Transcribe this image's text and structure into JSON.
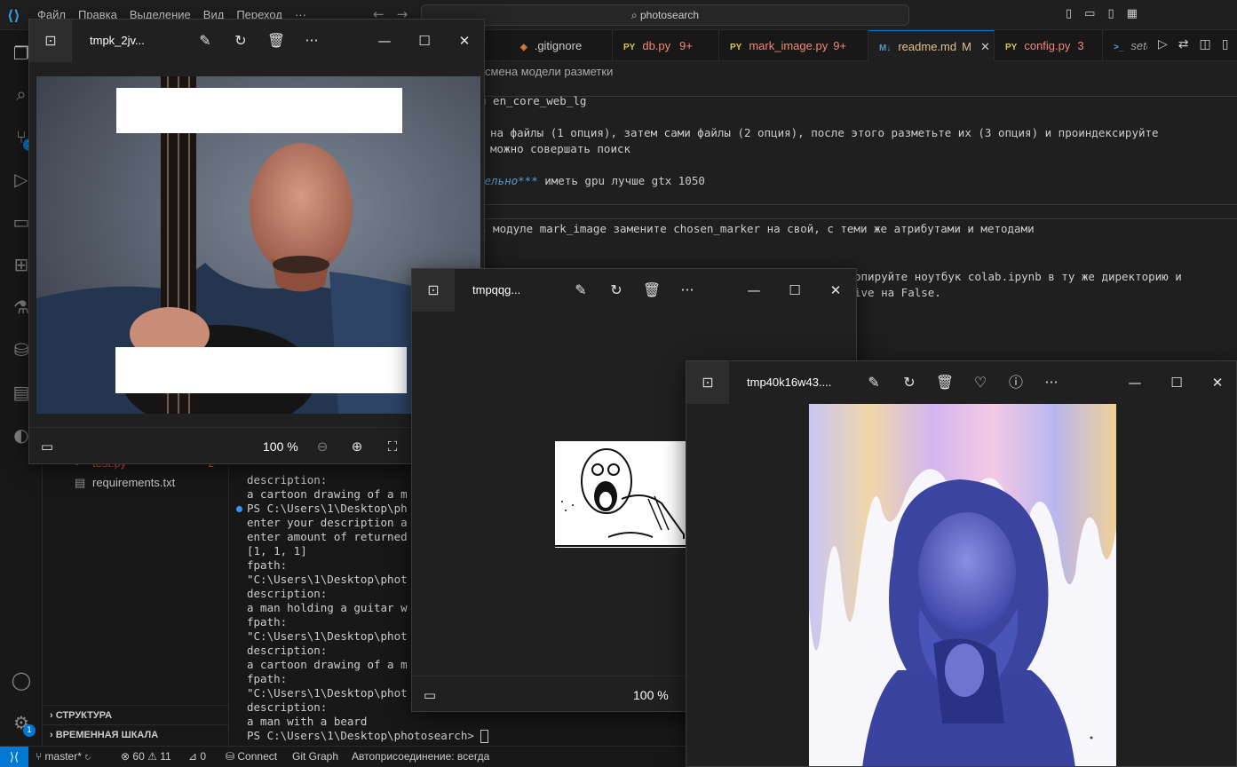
{
  "titlebar": {
    "menu": [
      "Файл",
      "Правка",
      "Выделение",
      "Вид",
      "Переход",
      "···"
    ],
    "search": "photosearch"
  },
  "activity": {
    "icons": [
      "files-icon",
      "search-icon",
      "source-control-icon",
      "run-debug-icon",
      "remote-explorer-icon",
      "extensions-icon",
      "testing-icon",
      "database-icon",
      "docker-icon",
      "gitlens-icon"
    ],
    "scm_badge": "1",
    "settings_badge": "1"
  },
  "sidebar": {
    "files": [
      {
        "name": "test.py",
        "count": "2"
      },
      {
        "name": "requirements.txt"
      }
    ],
    "sections": [
      "СТРУКТУРА",
      "ВРЕМЕННАЯ ШКАЛА"
    ]
  },
  "tabs": [
    {
      "type": "◈",
      "name": ".gitignore",
      "color": "#cccccc"
    },
    {
      "type": "PY",
      "name": "db.py",
      "badge": "9+",
      "color": "#f48771"
    },
    {
      "type": "PY",
      "name": "mark_image.py",
      "badge": "9+",
      "color": "#f48771"
    },
    {
      "type": "M↓",
      "name": "readme.md",
      "badge": "M",
      "color": "#e2c08d"
    },
    {
      "type": "PY",
      "name": "config.py",
      "badge": "3",
      "color": "#f48771"
    },
    {
      "type": ">_",
      "name": "setu",
      "color": "#a0a0a0"
    }
  ],
  "editor": {
    "breadcrumb": "смена модели разметки",
    "lines": [
      "u en_core_web_lg",
      "на файлы (1 опция), затем сами файлы (2 опция), после этого разметьте их (3 опция) и проиндексируйте",
      "можно совершать поиск",
      "тельно***",
      " иметь gpu лучше gtx 1050",
      "в модуле mark_image замените chosen_marker на свой, с теми же атрибутами и методами",
      "опируйте ноутбук colab.ipynb в ту же директорию и",
      "ive на False."
    ]
  },
  "terminal": {
    "lines": [
      "description:",
      "a cartoon drawing of a m",
      "PS C:\\Users\\1\\Desktop\\ph",
      "enter your description a",
      "enter amount of returned",
      "[1, 1, 1]",
      "fpath:",
      "\"C:\\Users\\1\\Desktop\\phot",
      "description:",
      "a man holding a guitar w",
      "fpath:",
      "\"C:\\Users\\1\\Desktop\\phot",
      "description:",
      "a cartoon drawing of a m",
      "fpath:",
      "\"C:\\Users\\1\\Desktop\\phot",
      "description:",
      "a man with a beard",
      "PS C:\\Users\\1\\Desktop\\photosearch> "
    ]
  },
  "statusbar": {
    "branch": "master*",
    "errors": "60",
    "warnings": "11",
    "ports": "0",
    "connect": "Connect",
    "gitgraph": "Git Graph",
    "autoattach": "Автоприсоединение: всегда"
  },
  "photo_windows": [
    {
      "title": "tmpk_2jv...",
      "zoom": "100 %"
    },
    {
      "title": "tmpqqg...",
      "zoom": "100 %"
    },
    {
      "title": "tmp40k16w43...."
    }
  ],
  "colors": {
    "accent": "#0078d4",
    "error": "#f14c4c",
    "window_bg": "#202020"
  }
}
